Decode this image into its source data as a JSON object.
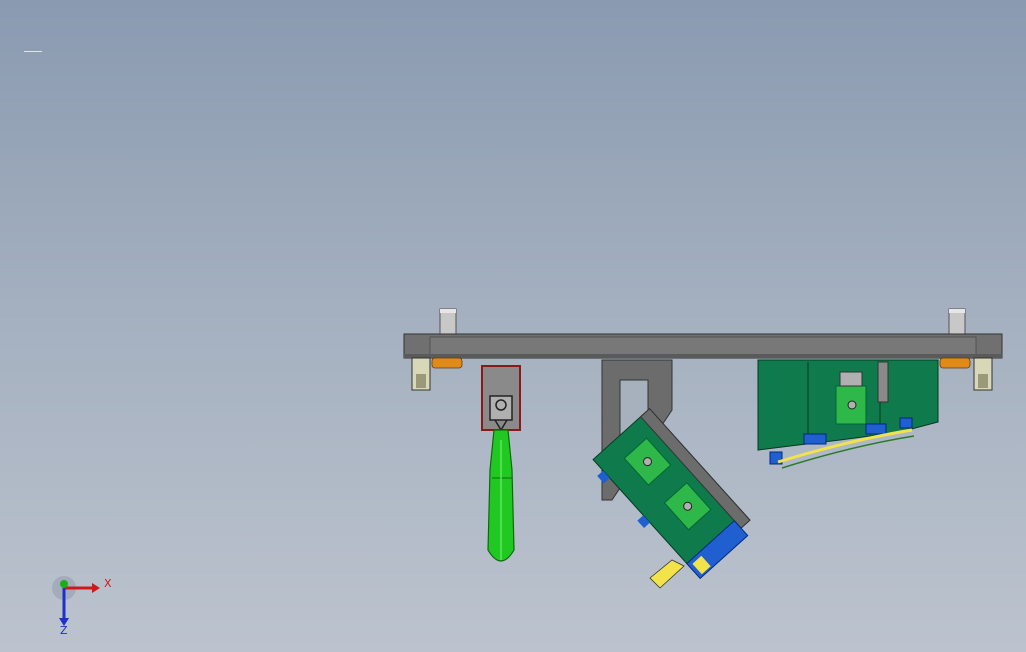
{
  "viewport": {
    "background_top": "#8a9ab0",
    "background_bottom": "#bcc3ce"
  },
  "triad": {
    "x_label": "X",
    "z_label": "Z",
    "x_color": "#d01818",
    "y_color": "#18b018",
    "z_color": "#1c30d0"
  },
  "model": {
    "plate_color": "#6e6e6e",
    "bracket_color": "#707070",
    "handle_color": "#22c822",
    "part_green": "#1f9a3a",
    "part_dark_green": "#0f7a4c",
    "blue": "#1f5fd0",
    "yellow": "#f2e34a",
    "orange": "#e08a1a",
    "pin_color": "#c8c8c8"
  }
}
